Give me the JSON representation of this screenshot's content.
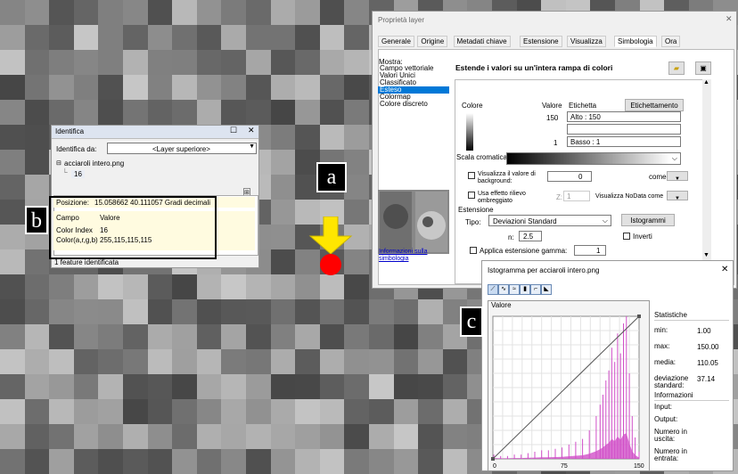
{
  "colors": {
    "arrow": "#ffe600",
    "dot": "#ff0000",
    "histogram_bar": "#d14fc8",
    "ramp_min": "#000000",
    "ramp_max": "#ffffff",
    "highlight_row": "#fffbe0"
  },
  "callouts": {
    "a": "a",
    "b": "b",
    "c": "c"
  },
  "identify": {
    "title": "Identifica",
    "identify_from_label": "Identifica da:",
    "layer_select": "<Layer superiore>",
    "tree_layer": "acciaroli intero.png",
    "tree_child": "16",
    "position_label": "Posizione:",
    "position_value": "15.058662  40.111057 Gradi decimali",
    "table_headers": [
      "Campo",
      "Valore"
    ],
    "rows": [
      {
        "field": "Color Index",
        "value": "16"
      },
      {
        "field": "Color(a,r,g,b)",
        "value": "255,115,115,115"
      }
    ],
    "status": "1 feature identificata"
  },
  "props": {
    "title": "Proprietà layer",
    "tabs": [
      "Generale",
      "Origine",
      "Metadati chiave",
      "Estensione",
      "Visualizza",
      "Simbologia",
      "Ora"
    ],
    "active_tab": 5,
    "show_label": "Mostra:",
    "show_items": [
      "Campo vettoriale",
      "Valori Unici",
      "Classificato",
      "Esteso",
      "Colormap",
      "Colore discreto"
    ],
    "selected_item": 3,
    "info_link": "Informazioni sulla simbologia",
    "heading": "Estende i valori su un'intera rampa di colori",
    "col_color": "Colore",
    "col_value": "Valore",
    "col_label": "Etichetta",
    "labeling_button": "Etichettamento",
    "high_value": "150",
    "high_label": "Alto : 150",
    "low_value": "1",
    "low_label": "Basso : 1",
    "ramp_label": "Scala cromatica:",
    "bg_label": "Visualizza il valore di background:",
    "bg_value": "0",
    "come_label": "come",
    "hillshade_label": "Usa effetto rilievo ombreggiato",
    "z_label": "Z:",
    "z_value": "1",
    "nodata_label": "Visualizza NoData come",
    "stretch_label": "Estensione",
    "type_label": "Tipo:",
    "type_value": "Deviazioni Standard",
    "histogram_button": "Istogrammi",
    "n_label": "n:",
    "n_value": "2.5",
    "invert_label": "Inverti",
    "gamma_label": "Applica estensione gamma:",
    "gamma_value": "1"
  },
  "hist": {
    "title": "Istogramma per acciaroli intero.png",
    "tab": "Valore",
    "stats_title": "Statistiche",
    "stats": [
      {
        "label": "min:",
        "value": "1.00"
      },
      {
        "label": "max:",
        "value": "150.00"
      },
      {
        "label": "media:",
        "value": "110.05"
      },
      {
        "label": "deviazione standard:",
        "value": "37.14"
      }
    ],
    "info_title": "Informazioni",
    "info": [
      "Input:",
      "Output:",
      "Numero in uscita:",
      "Numero in entrata:"
    ],
    "x_ticks": [
      "0",
      "75",
      "150"
    ]
  },
  "chart_data": {
    "type": "bar",
    "xlim": [
      0,
      150
    ],
    "x": [
      1,
      8,
      15,
      22,
      29,
      36,
      43,
      50,
      57,
      64,
      71,
      78,
      85,
      92,
      99,
      106,
      110,
      113,
      116,
      119,
      122,
      125,
      128,
      131,
      134,
      137,
      140,
      143,
      146,
      150
    ],
    "values": [
      0.03,
      0.02,
      0.02,
      0.03,
      0.03,
      0.04,
      0.05,
      0.06,
      0.06,
      0.07,
      0.08,
      0.1,
      0.12,
      0.14,
      0.2,
      0.3,
      0.38,
      0.45,
      0.55,
      0.62,
      0.78,
      0.68,
      0.88,
      0.74,
      0.95,
      1.0,
      0.6,
      0.3,
      0.15,
      0.05
    ]
  }
}
